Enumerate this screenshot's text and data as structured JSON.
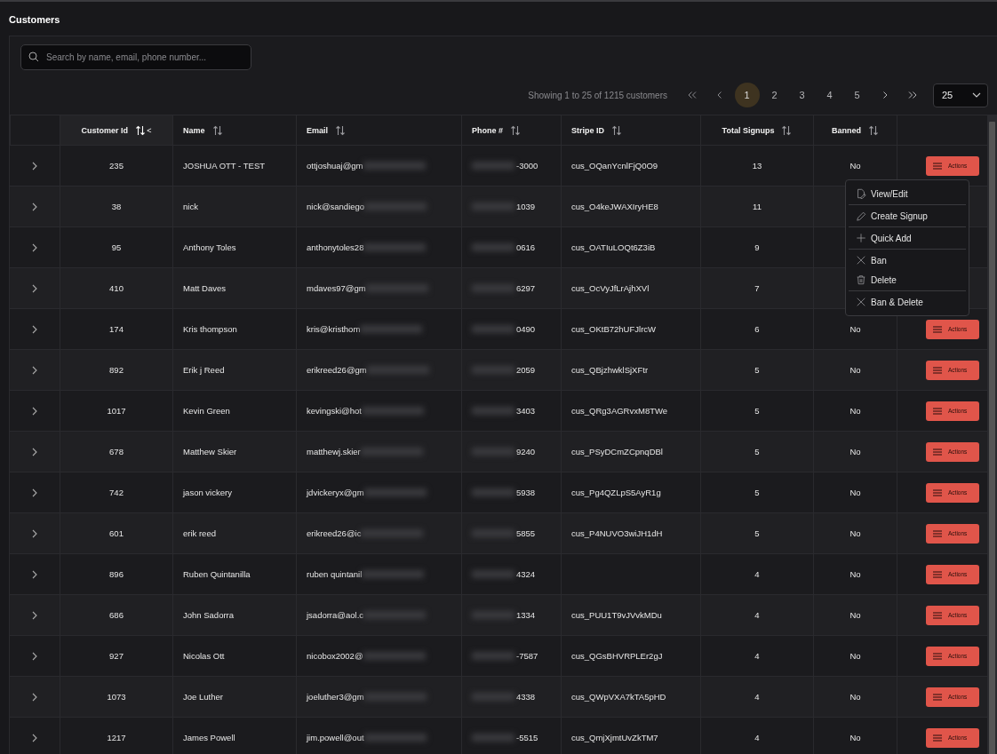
{
  "page": {
    "title": "Customers"
  },
  "search": {
    "placeholder": "Search by name, email, phone number..."
  },
  "pagination": {
    "summary": "Showing 1 to 25 of 1215 customers",
    "pages": [
      {
        "label": "1",
        "selected": true
      },
      {
        "label": "2",
        "selected": false
      },
      {
        "label": "3",
        "selected": false
      },
      {
        "label": "4",
        "selected": false
      },
      {
        "label": "5",
        "selected": false
      }
    ],
    "page_size": "25"
  },
  "table": {
    "columns": [
      {
        "label": "Customer Id",
        "sorted": true,
        "suffix": "<"
      },
      {
        "label": "Name",
        "sorted": false
      },
      {
        "label": "Email",
        "sorted": false
      },
      {
        "label": "Phone #",
        "sorted": false
      },
      {
        "label": "Stripe ID",
        "sorted": false
      },
      {
        "label": "Total Signups",
        "sorted": false
      },
      {
        "label": "Banned",
        "sorted": false
      }
    ],
    "rows": [
      {
        "id": "235",
        "name": "JOSHUA OTT - TEST",
        "email": "ottjoshuaj@gm",
        "phone": "-3000",
        "stripe_id": "cus_OQanYcnlFjQ0O9",
        "total_signups": "13",
        "banned": "No",
        "action": "Actions"
      },
      {
        "id": "38",
        "name": "nick",
        "email": "nick@sandiego",
        "phone": "1039",
        "stripe_id": "cus_O4keJWAXIryHE8",
        "total_signups": "11"
      },
      {
        "id": "95",
        "name": "Anthony Toles",
        "email": "anthonytoles28",
        "phone": "0616",
        "stripe_id": "cus_OATIuLOQt6Z3iB",
        "total_signups": "9"
      },
      {
        "id": "410",
        "name": "Matt Daves",
        "email": "mdaves97@gm",
        "phone": "6297",
        "stripe_id": "cus_OcVyJfLrAjhXVl",
        "total_signups": "7"
      },
      {
        "id": "174",
        "name": "Kris thompson",
        "email": "kris@kristhom",
        "phone": "0490",
        "stripe_id": "cus_OKtB72hUFJlrcW",
        "total_signups": "6",
        "banned": "No",
        "action": "Actions"
      },
      {
        "id": "892",
        "name": "Erik j Reed",
        "email": "erikreed26@gm",
        "phone": "2059",
        "stripe_id": "cus_QBjzhwklSjXFtr",
        "total_signups": "5",
        "banned": "No",
        "action": "Actions"
      },
      {
        "id": "1017",
        "name": "Kevin Green",
        "email": "kevingski@hot",
        "phone": "3403",
        "stripe_id": "cus_QRg3AGRvxM8TWe",
        "total_signups": "5",
        "banned": "No",
        "action": "Actions"
      },
      {
        "id": "678",
        "name": "Matthew Skier",
        "email": "matthewj.skier",
        "phone": "9240",
        "stripe_id": "cus_PSyDCmZCpnqDBl",
        "total_signups": "5",
        "banned": "No",
        "action": "Actions"
      },
      {
        "id": "742",
        "name": "jason vickery",
        "email": "jdvickeryx@gm",
        "phone": "5938",
        "stripe_id": "cus_Pg4QZLpS5AyR1g",
        "total_signups": "5",
        "banned": "No",
        "action": "Actions"
      },
      {
        "id": "601",
        "name": "erik reed",
        "email": "erikreed26@ic",
        "phone": "5855",
        "stripe_id": "cus_P4NUVO3wiJH1dH",
        "total_signups": "5",
        "banned": "No",
        "action": "Actions"
      },
      {
        "id": "896",
        "name": "Ruben Quintanilla",
        "email": "ruben quintanil",
        "phone": "4324",
        "total_signups": "4",
        "banned": "No",
        "action": "Actions"
      },
      {
        "id": "686",
        "name": "John Sadorra",
        "email": "jsadorra@aol.c",
        "phone": "1334",
        "stripe_id": "cus_PUU1T9vJVvkMDu",
        "total_signups": "4",
        "banned": "No",
        "action": "Actions"
      },
      {
        "id": "927",
        "name": "Nicolas Ott",
        "email": "nicobox2002@",
        "phone": "-7587",
        "stripe_id": "cus_QGsBHVRPLEr2gJ",
        "total_signups": "4",
        "banned": "No",
        "action": "Actions"
      },
      {
        "id": "1073",
        "name": "Joe Luther",
        "email": "joeluther3@gm",
        "phone": "4338",
        "stripe_id": "cus_QWpVXA7kTA5pHD",
        "total_signups": "4",
        "banned": "No",
        "action": "Actions"
      },
      {
        "id": "1217",
        "name": "James Powell",
        "email": "jim.powell@out",
        "phone": "-5515",
        "stripe_id": "cus_QmjXjmtUvZkTM7",
        "total_signups": "4",
        "banned": "No",
        "action": "Actions"
      }
    ]
  },
  "actions_menu": {
    "groups": [
      [
        "View/Edit"
      ],
      [
        "Create Signup"
      ],
      [
        "Quick Add"
      ],
      [
        "Ban",
        "Delete"
      ],
      [
        "Ban & Delete"
      ]
    ]
  }
}
